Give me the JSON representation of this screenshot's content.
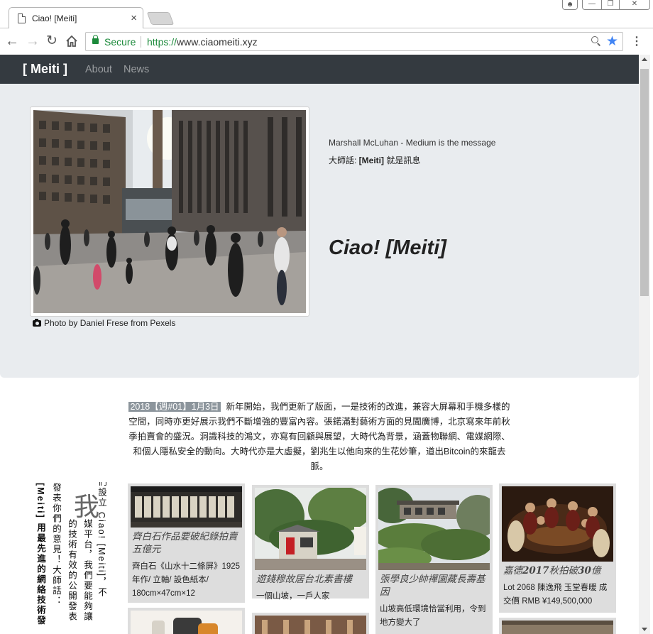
{
  "browser": {
    "tab_title": "Ciao! [Meiti]",
    "secure_label": "Secure",
    "url_scheme": "https://",
    "url_host": "www.ciaomeiti.xyz"
  },
  "navbar": {
    "brand": "[ Meiti ]",
    "links": [
      "About",
      "News"
    ]
  },
  "hero": {
    "caption": "Photo by Daniel Frese from Pexels",
    "quote_en": "Marshall McLuhan - Medium is the message",
    "quote_zh_prefix": "大師話: ",
    "quote_zh_brand": "[Meiti]",
    "quote_zh_suffix": " 就是訊息",
    "title": "Ciao! [Meiti]"
  },
  "intro": {
    "date": "2018【週#01】1月3日",
    "text": "新年開始，我們更新了版面，一是技術的改進，兼容大屏幕和手機多樣的空間，同時亦更好展示我們不斷增強的豐富內容。張鍩滿對藝術方面的見聞廣博，北京寫來年前秋季拍賣會的盛況。洞識科技的鴻文，亦寫有回顧與展望，大時代為背景，涵蓋物聯網、電媒網際、和個人隱私安全的動向。大時代亦是大虛擬，劉兆生以他向來的生花妙筆，道出Bitcoin的來龍去脈。"
  },
  "vertical": {
    "big_char": "我",
    "col1": "們設立 Ciao! [Meiti]，不",
    "col2": "媒平台，我們要能夠讓",
    "col3": "的技術有效的公開發表",
    "col4": "發表你們的意見！大師話：",
    "col5": "[Meiti] 用最先進的網絡技術發"
  },
  "cards": [
    {
      "title": "齊白石作品要破紀錄拍賣五億元",
      "text": "齊白石《山水十二條屏》1925年作/ 立軸/ 設色紙本/ 180cm×47cm×12"
    },
    {
      "title": "遊錢穆故居台北素書樓",
      "text": "一個山坡，一戶人家"
    },
    {
      "title": "張學良少帥禪園藏長壽基因",
      "text": "山坡高低環境恰當利用，令到地方變大了"
    },
    {
      "title_pre": "嘉德",
      "title_bold": "2017",
      "title_mid": "秋拍破",
      "title_bold2": "30",
      "title_post": "億",
      "text": "Lot 2068 陳逸飛 玉堂春暖 成交價 RMB ¥149,500,000"
    }
  ],
  "colors": {
    "navbar_bg": "#343a40",
    "jumbotron_bg": "#e9ecef",
    "secure_green": "#1c8a3b",
    "star_blue": "#4285f4"
  }
}
